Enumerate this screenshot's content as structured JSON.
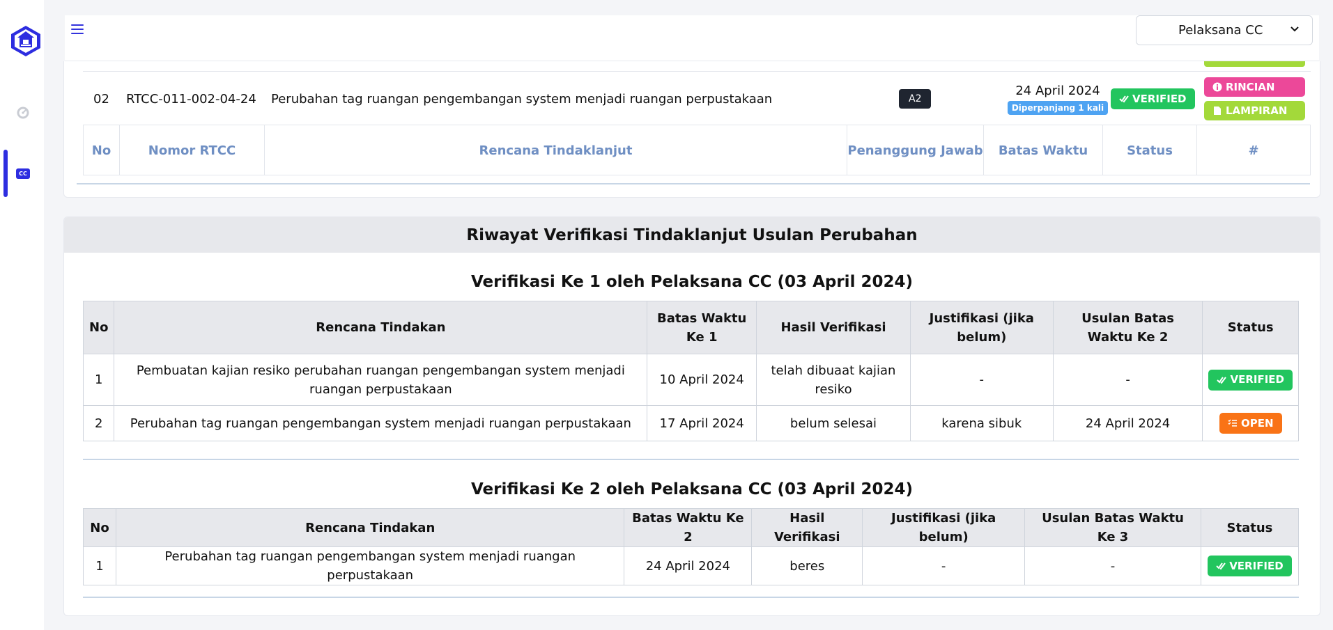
{
  "header": {
    "role_selected": "Pelaksana CC"
  },
  "sidebar": {
    "cc_label": "CC"
  },
  "upper_table": {
    "row": {
      "no": "02",
      "nomor": "RTCC-011-002-04-24",
      "rencana": "Perubahan tag ruangan pengembangan system menjadi ruangan perpustakaan",
      "penanggung": "A2",
      "batas_date": "24 April 2024",
      "batas_note": "Diperpanjang 1 kali",
      "status": "VERIFIED",
      "btn_rincian": "RINCIAN",
      "btn_lampiran": "LAMPIRAN"
    },
    "headers": {
      "no": "No",
      "nomor": "Nomor RTCC",
      "rencana": "Rencana Tindaklanjut",
      "penanggung": "Penanggung Jawab",
      "batas": "Batas Waktu",
      "status": "Status",
      "aksi": "#"
    }
  },
  "history": {
    "title": "Riwayat Verifikasi Tindaklanjut Usulan Perubahan",
    "v1": {
      "title": "Verifikasi Ke 1 oleh Pelaksana CC (03 April 2024)",
      "headers": {
        "no": "No",
        "rencana": "Rencana Tindakan",
        "batas": "Batas Waktu Ke 1",
        "hasil": "Hasil Verifikasi",
        "justifikasi": "Justifikasi (jika belum)",
        "usulan": "Usulan Batas Waktu Ke 2",
        "status": "Status"
      },
      "rows": [
        {
          "no": "1",
          "rencana": "Pembuatan kajian resiko perubahan ruangan pengembangan system menjadi ruangan perpustakaan",
          "batas": "10 April 2024",
          "hasil": "telah dibuaat kajian resiko",
          "justifikasi": "-",
          "usulan": "-",
          "status": "VERIFIED"
        },
        {
          "no": "2",
          "rencana": "Perubahan tag ruangan pengembangan system menjadi ruangan perpustakaan",
          "batas": "17 April 2024",
          "hasil": "belum selesai",
          "justifikasi": "karena sibuk",
          "usulan": "24 April 2024",
          "status": "OPEN"
        }
      ]
    },
    "v2": {
      "title": "Verifikasi Ke 2 oleh Pelaksana CC (03 April 2024)",
      "headers": {
        "no": "No",
        "rencana": "Rencana Tindakan",
        "batas": "Batas Waktu Ke 2",
        "hasil": "Hasil Verifikasi",
        "justifikasi": "Justifikasi (jika belum)",
        "usulan": "Usulan Batas Waktu Ke 3",
        "status": "Status"
      },
      "rows": [
        {
          "no": "1",
          "rencana": "Perubahan tag ruangan pengembangan system menjadi ruangan perpustakaan",
          "batas": "24 April 2024",
          "hasil": "beres",
          "justifikasi": "-",
          "usulan": "-",
          "status": "VERIFIED"
        }
      ]
    }
  },
  "colors": {
    "accent": "#2d2de0",
    "verified": "#22c55e",
    "open": "#f97316",
    "rincian": "#ec4899",
    "lampiran": "#a3d93a",
    "header_text": "#6f8fc3"
  }
}
